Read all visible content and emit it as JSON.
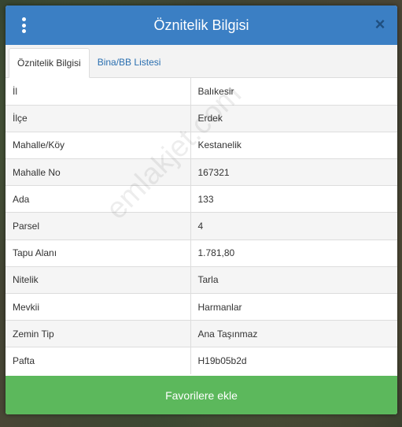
{
  "header": {
    "title": "Öznitelik Bilgisi",
    "close_label": "×"
  },
  "tabs": [
    {
      "label": "Öznitelik Bilgisi",
      "active": true
    },
    {
      "label": "Bina/BB Listesi",
      "active": false
    }
  ],
  "attributes": [
    {
      "key": "İl",
      "value": "Balıkesir"
    },
    {
      "key": "İlçe",
      "value": "Erdek"
    },
    {
      "key": "Mahalle/Köy",
      "value": "Kestanelik"
    },
    {
      "key": "Mahalle No",
      "value": "167321"
    },
    {
      "key": "Ada",
      "value": "133"
    },
    {
      "key": "Parsel",
      "value": "4"
    },
    {
      "key": "Tapu Alanı",
      "value": "1.781,80"
    },
    {
      "key": "Nitelik",
      "value": "Tarla"
    },
    {
      "key": "Mevkii",
      "value": "Harmanlar"
    },
    {
      "key": "Zemin Tip",
      "value": "Ana Taşınmaz"
    },
    {
      "key": "Pafta",
      "value": "H19b05b2d"
    }
  ],
  "watermark": "emlakjet.com",
  "footer": {
    "favorite_label": "Favorilere ekle"
  },
  "colors": {
    "header": "#3b7fc4",
    "button": "#5cb85c",
    "tab_link": "#2a6fb0"
  }
}
